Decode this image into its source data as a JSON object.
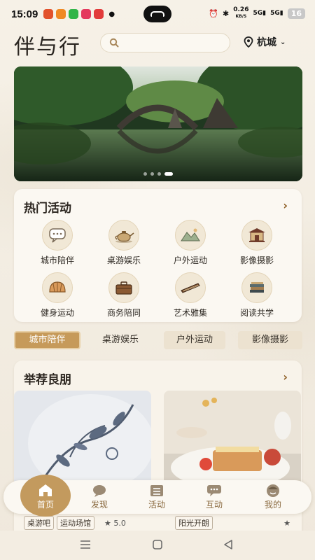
{
  "status_bar": {
    "time": "15:09",
    "net_speed_value": "0.26",
    "net_speed_unit": "KB/S",
    "signal1": "5G",
    "signal2": "5G",
    "battery": "16"
  },
  "header": {
    "app_title": "伴与行",
    "search_placeholder": "",
    "city": "杭城"
  },
  "banner": {
    "slides": 4,
    "active_slide": 3
  },
  "hot_activities": {
    "title": "热门活动",
    "more": "›",
    "items": [
      {
        "label": "城市陪伴",
        "icon": "chat-bubble-icon"
      },
      {
        "label": "桌游娱乐",
        "icon": "teapot-icon"
      },
      {
        "label": "户外运动",
        "icon": "landscape-icon"
      },
      {
        "label": "影像摄影",
        "icon": "pavilion-icon"
      },
      {
        "label": "健身运动",
        "icon": "seashell-icon"
      },
      {
        "label": "商务陪同",
        "icon": "briefcase-icon"
      },
      {
        "label": "艺术雅集",
        "icon": "guqin-icon"
      },
      {
        "label": "阅读共学",
        "icon": "books-icon"
      }
    ]
  },
  "tabs": [
    {
      "label": "城市陪伴",
      "active": true
    },
    {
      "label": "桌游娱乐",
      "active": false
    },
    {
      "label": "户外运动",
      "active": false
    },
    {
      "label": "影像摄影",
      "active": false
    }
  ],
  "recommend": {
    "title": "举荐良朋",
    "more": "›",
    "cards": [
      {
        "tags": [
          "桌游吧",
          "运动场馆"
        ],
        "rating": "★ 5.0"
      },
      {
        "tags": [
          "阳光开朗"
        ],
        "rating": "★"
      }
    ]
  },
  "bottom_nav": [
    {
      "label": "首页",
      "icon": "home-icon",
      "active": true
    },
    {
      "label": "发现",
      "icon": "discover-icon",
      "active": false
    },
    {
      "label": "活动",
      "icon": "list-icon",
      "active": false
    },
    {
      "label": "互动",
      "icon": "message-icon",
      "active": false
    },
    {
      "label": "我的",
      "icon": "profile-icon",
      "active": false
    }
  ],
  "colors": {
    "accent": "#c39a5e",
    "background": "#f3ede2",
    "card": "#fbf8f2"
  }
}
